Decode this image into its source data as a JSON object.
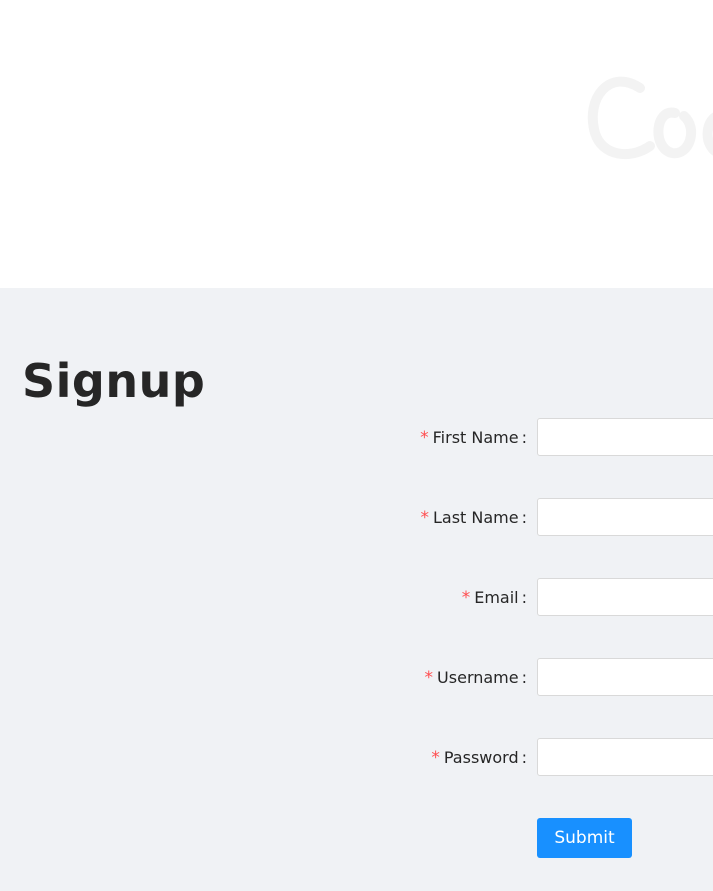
{
  "hero": {
    "logo_icon": "script-logo-icon",
    "logo_color": "#f2f2f2"
  },
  "signup": {
    "title": "Signup",
    "colon": ":",
    "required_mark": "*",
    "fields": [
      {
        "label": "First Name",
        "value": "",
        "placeholder": ""
      },
      {
        "label": "Last Name",
        "value": "",
        "placeholder": ""
      },
      {
        "label": "Email",
        "value": "",
        "placeholder": ""
      },
      {
        "label": "Username",
        "value": "",
        "placeholder": ""
      },
      {
        "label": "Password",
        "value": "",
        "placeholder": ""
      }
    ],
    "submit_label": "Submit"
  },
  "colors": {
    "background": "#f0f2f5",
    "primary": "#1890ff",
    "required": "#ff4d4f",
    "text": "#262626",
    "border": "#d9d9d9"
  }
}
